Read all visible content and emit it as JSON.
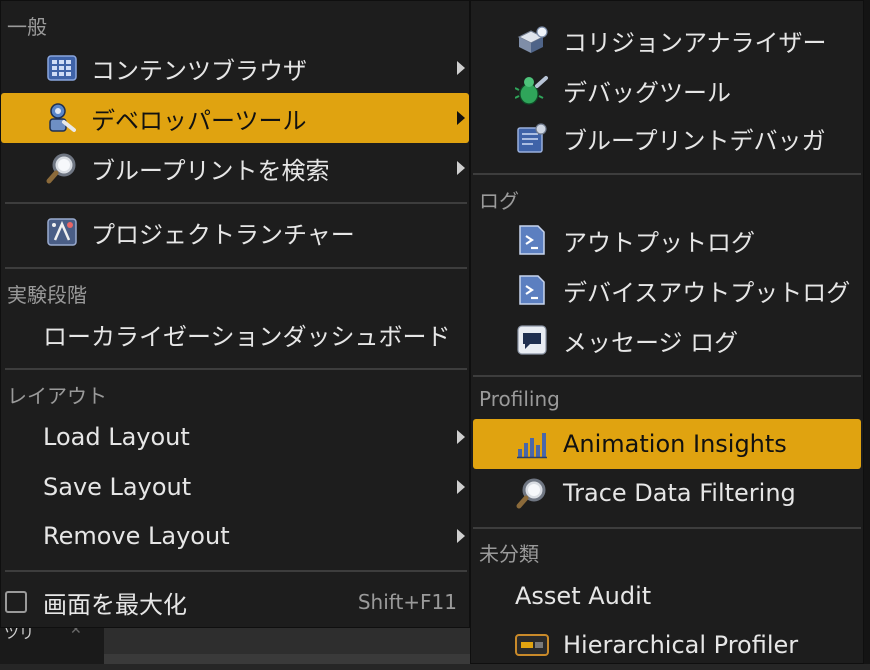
{
  "bottom_tab": {
    "label": "ツリ",
    "close": "✕"
  },
  "main_menu": {
    "general_header": "一般",
    "general_items": [
      {
        "label": "コンテンツブラウザ",
        "icon": "grid-icon",
        "submenu": true
      },
      {
        "label": "デベロッパーツール",
        "icon": "developer-tools-icon",
        "submenu": true,
        "active": true
      },
      {
        "label": "ブループリントを検索",
        "icon": "magnifier-icon",
        "submenu": true
      },
      {
        "label": "プロジェクトランチャー",
        "icon": "launcher-icon",
        "submenu": false
      }
    ],
    "experimental_header": "実験段階",
    "experimental_items": [
      {
        "label": "ローカライゼーションダッシュボード"
      }
    ],
    "layout_header": "レイアウト",
    "layout_items": [
      {
        "label": "Load Layout",
        "submenu": true
      },
      {
        "label": "Save Layout",
        "submenu": true
      },
      {
        "label": "Remove Layout",
        "submenu": true
      }
    ],
    "maximize": {
      "label": "画面を最大化",
      "shortcut": "Shift+F11",
      "checked": false
    }
  },
  "sub_menu": {
    "tools_items": [
      {
        "label": "コリジョンアナライザー",
        "icon": "collision-analyzer-icon"
      },
      {
        "label": "デバッグツール",
        "icon": "debug-tools-icon"
      },
      {
        "label": "ブループリントデバッガ",
        "icon": "blueprint-debugger-icon"
      }
    ],
    "log_header": "ログ",
    "log_items": [
      {
        "label": "アウトプットログ",
        "icon": "output-log-icon"
      },
      {
        "label": "デバイスアウトプットログ",
        "icon": "device-output-log-icon"
      },
      {
        "label": "メッセージ ログ",
        "icon": "message-log-icon"
      }
    ],
    "profiling_header": "Profiling",
    "profiling_items": [
      {
        "label": "Animation Insights",
        "icon": "bar-chart-icon",
        "active": true
      },
      {
        "label": "Trace Data Filtering",
        "icon": "magnifier-icon"
      }
    ],
    "uncategorized_header": "未分類",
    "uncategorized_items": [
      {
        "label": "Asset Audit",
        "icon": ""
      },
      {
        "label": "Hierarchical Profiler",
        "icon": "profiler-icon"
      }
    ]
  },
  "colors": {
    "highlight": "#e0a310",
    "menu_bg": "#1d1d1d",
    "header_text": "#9a9a9a"
  }
}
